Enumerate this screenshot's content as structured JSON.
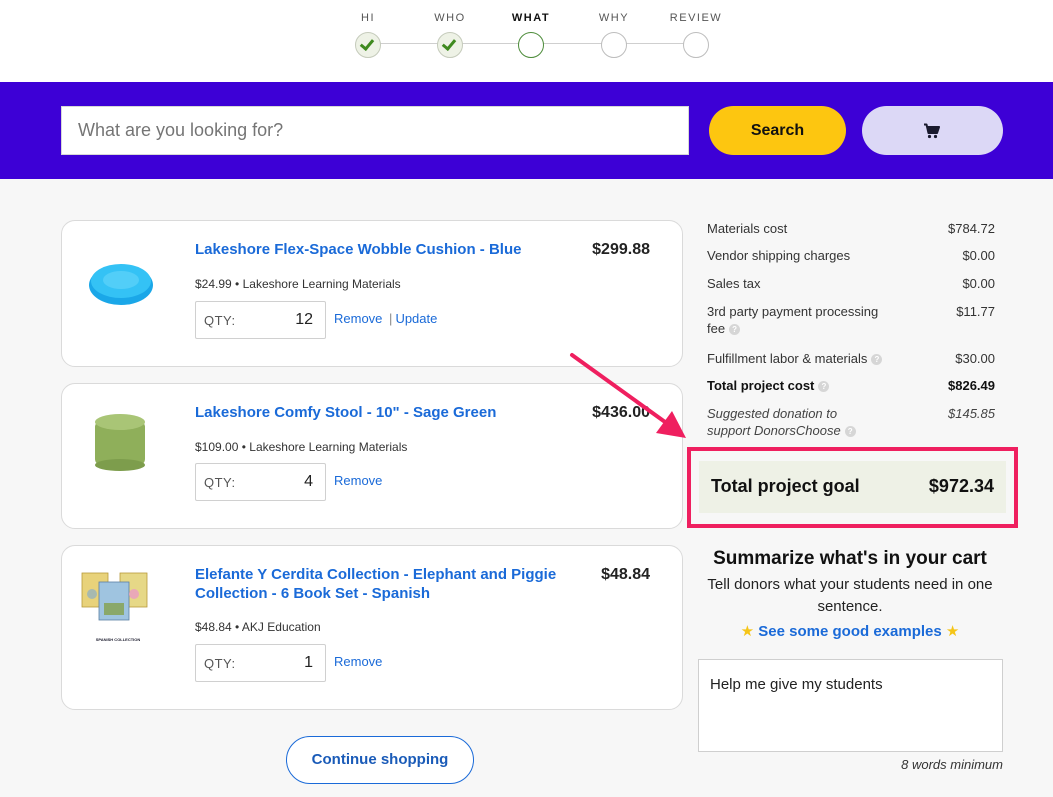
{
  "stepper": {
    "steps": [
      {
        "label": "HI",
        "state": "done"
      },
      {
        "label": "WHO",
        "state": "done"
      },
      {
        "label": "WHAT",
        "state": "current"
      },
      {
        "label": "WHY",
        "state": "pending"
      },
      {
        "label": "REVIEW",
        "state": "pending"
      }
    ]
  },
  "search": {
    "placeholder": "What are you looking for?",
    "button_label": "Search",
    "cart_icon": "cart-icon"
  },
  "items": [
    {
      "title": "Lakeshore Flex-Space Wobble Cushion - Blue",
      "price": "$299.88",
      "unit_price": "$24.99",
      "vendor": "Lakeshore Learning Materials",
      "qty_label": "QTY:",
      "qty": "12",
      "remove_label": "Remove",
      "separator": "|",
      "update_label": "Update"
    },
    {
      "title": "Lakeshore Comfy Stool - 10\" - Sage Green",
      "price": "$436.00",
      "unit_price": "$109.00",
      "vendor": "Lakeshore Learning Materials",
      "qty_label": "QTY:",
      "qty": "4",
      "remove_label": "Remove"
    },
    {
      "title": "Elefante Y Cerdita Collection - Elephant and Piggie Collection - 6 Book Set - Spanish",
      "price": "$48.84",
      "unit_price": "$48.84",
      "vendor": "AKJ Education",
      "qty_label": "QTY:",
      "qty": "1",
      "remove_label": "Remove",
      "thumb_caption": "SPANISH COLLECTION"
    }
  ],
  "meta_separator": "•",
  "continue_label": "Continue shopping",
  "summary": {
    "materials_cost": {
      "label": "Materials cost",
      "value": "$784.72"
    },
    "vendor_shipping": {
      "label": "Vendor shipping charges",
      "value": "$0.00"
    },
    "sales_tax": {
      "label": "Sales tax",
      "value": "$0.00"
    },
    "payment_fee": {
      "label_line1": "3rd party payment processing",
      "label_line2": "fee",
      "value": "$11.77"
    },
    "fulfillment": {
      "label": "Fulfillment labor & materials",
      "value": "$30.00"
    },
    "total_cost": {
      "label": "Total project cost",
      "value": "$826.49"
    },
    "donation": {
      "label_line1": "Suggested donation to",
      "label_line2": "support DonorsChoose",
      "value": "$145.85"
    },
    "goal": {
      "label": "Total project goal",
      "value": "$972.34"
    },
    "help_mark": "?"
  },
  "cart_summary": {
    "title": "Summarize what's in your cart",
    "subtitle": "Tell donors what your students need in one sentence.",
    "star": "★",
    "examples_label": "See some good examples",
    "text": "Help me give my students",
    "min_words": "8 words minimum"
  },
  "colors": {
    "brand_purple": "#3d00d6",
    "search_yellow": "#fdc610",
    "link_blue": "#1a6ad8",
    "highlight_pink": "#ef1f5f",
    "check_green": "#3f8a1f"
  }
}
